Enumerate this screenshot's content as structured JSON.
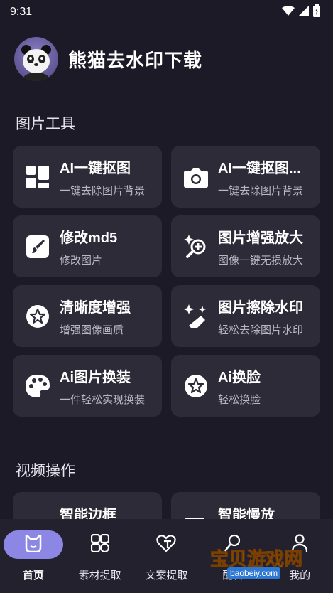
{
  "status": {
    "time": "9:31"
  },
  "app": {
    "title": "熊猫去水印下载"
  },
  "sections": {
    "image_tools": "图片工具",
    "video_ops": "视频操作"
  },
  "image_cards": [
    {
      "title": "AI一键抠图",
      "subtitle": "一键去除图片背景",
      "icon": "layout-grid-icon"
    },
    {
      "title": "AI一键抠图...",
      "subtitle": "一键去除图片背景",
      "icon": "camera-icon"
    },
    {
      "title": "修改md5",
      "subtitle": "修改图片",
      "icon": "brush-icon"
    },
    {
      "title": "图片增强放大",
      "subtitle": "图像一键无损放大",
      "icon": "sparkle-zoom-icon"
    },
    {
      "title": "清晰度增强",
      "subtitle": "增强图像画质",
      "icon": "star-badge-icon"
    },
    {
      "title": "图片擦除水印",
      "subtitle": "轻松去除图片水印",
      "icon": "magic-eraser-icon"
    },
    {
      "title": "Ai图片换装",
      "subtitle": "一件轻松实现换装",
      "icon": "palette-icon"
    },
    {
      "title": "Ai换脸",
      "subtitle": "轻松换脸",
      "icon": "star-badge-icon"
    }
  ],
  "video_cards": [
    {
      "title": "智能边框",
      "icon": "frame-icon"
    },
    {
      "title": "智能慢放",
      "icon": "fast-forward-icon"
    }
  ],
  "nav": [
    {
      "label": "首页",
      "icon": "home-icon",
      "active": true
    },
    {
      "label": "素材提取",
      "icon": "shapes-icon",
      "active": false
    },
    {
      "label": "文案提取",
      "icon": "text-extract-icon",
      "active": false
    },
    {
      "label": "配音",
      "icon": "mic-icon",
      "active": false
    },
    {
      "label": "我的",
      "icon": "person-icon",
      "active": false
    }
  ],
  "watermark": {
    "text": "宝贝游戏网",
    "url": "baobeiy.com"
  },
  "colors": {
    "background": "#1b1a26",
    "card": "#2c2b37",
    "accent": "#8c87e4"
  }
}
